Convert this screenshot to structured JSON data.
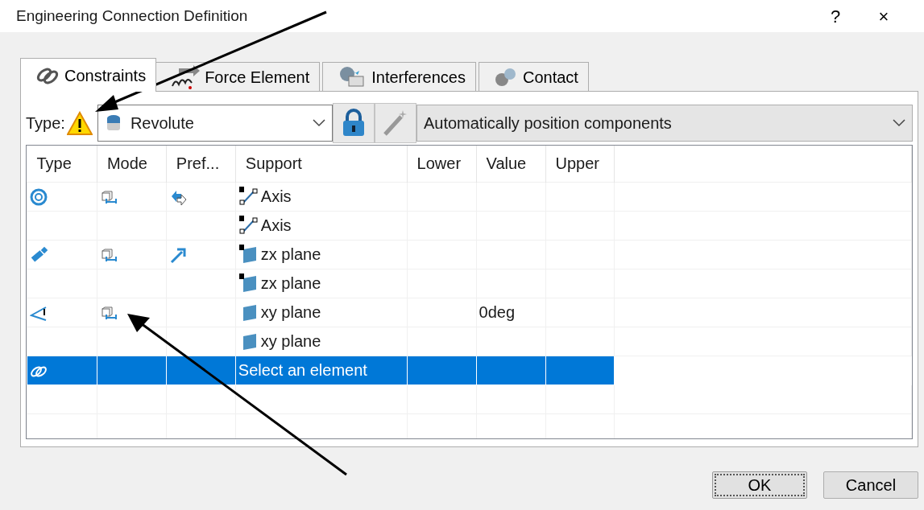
{
  "window": {
    "title": "Engineering Connection Definition",
    "help": "?",
    "close": "×"
  },
  "tabs": [
    {
      "label": "Constraints",
      "kind": "chain",
      "selected": true
    },
    {
      "label": "Force Element",
      "kind": "force",
      "selected": false
    },
    {
      "label": "Interferences",
      "kind": "interference",
      "selected": false
    },
    {
      "label": "Contact",
      "kind": "contact",
      "selected": false
    }
  ],
  "type_row": {
    "label": "Type:",
    "warning": true,
    "type_value": "Revolute",
    "lock_enabled": true,
    "wand_enabled": false,
    "positioning": "Automatically position components"
  },
  "table": {
    "columns": [
      "Type",
      "Mode",
      "Pref...",
      "Support",
      "Lower",
      "Value",
      "Upper"
    ],
    "rows": [
      {
        "kind": "axis",
        "support": {
          "text": "Axis",
          "kind": "locked-axis"
        },
        "value": "",
        "selected": false
      },
      {
        "kind": "continuation",
        "support": {
          "text": "Axis",
          "kind": "locked-axis"
        },
        "value": "",
        "selected": false
      },
      {
        "kind": "plane",
        "support": {
          "text": "zx plane",
          "kind": "locked-plane"
        },
        "value": "",
        "selected": false
      },
      {
        "kind": "continuation",
        "support": {
          "text": "zx plane",
          "kind": "locked-plane"
        },
        "value": "",
        "selected": false
      },
      {
        "kind": "angle",
        "support": {
          "text": "xy plane",
          "kind": "plane"
        },
        "value": "0deg",
        "selected": false
      },
      {
        "kind": "continuation",
        "support": {
          "text": "xy plane",
          "kind": "plane"
        },
        "value": "",
        "selected": false
      },
      {
        "kind": "new",
        "support": {
          "text": "Select an element",
          "kind": "none"
        },
        "value": "",
        "selected": true
      }
    ]
  },
  "buttons": [
    {
      "label": "OK",
      "default": true
    },
    {
      "label": "Cancel",
      "default": false
    }
  ]
}
